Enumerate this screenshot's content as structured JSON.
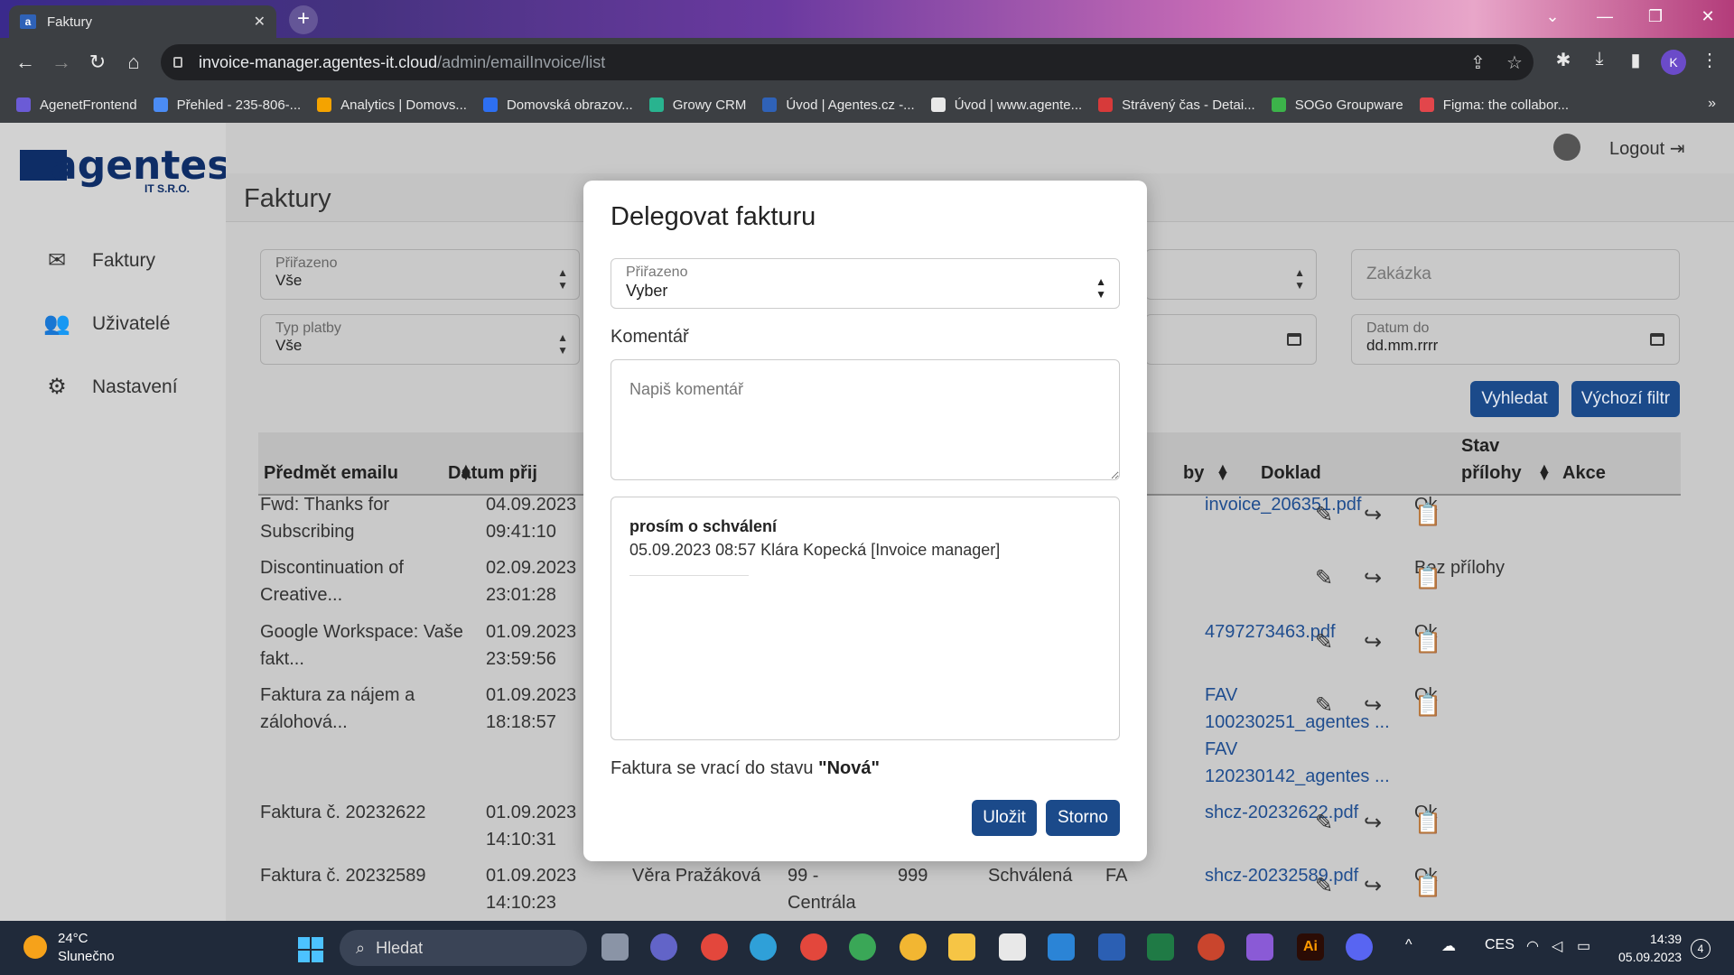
{
  "browser": {
    "tab_title": "Faktury",
    "tab_favicon": "a",
    "url_host": "invoice-manager.agentes-it.cloud",
    "url_path": "/admin/emailInvoice/list",
    "profile_initial": "K",
    "bookmarks": [
      {
        "label": "AgenetFrontend",
        "color": "#6b5bd6"
      },
      {
        "label": "Přehled - 235-806-...",
        "color": "#4b8cf5"
      },
      {
        "label": "Analytics | Domovs...",
        "color": "#f4a300"
      },
      {
        "label": "Domovská obrazov...",
        "color": "#2d6ff2"
      },
      {
        "label": "Growy CRM",
        "color": "#29b38f"
      },
      {
        "label": "Úvod | Agentes.cz -...",
        "color": "#2f62b8"
      },
      {
        "label": "Úvod | www.agente...",
        "color": "#e8e8e8"
      },
      {
        "label": "Strávený čas - Detai...",
        "color": "#d73a3a"
      },
      {
        "label": "SOGo Groupware",
        "color": "#3cb34a"
      },
      {
        "label": "Figma: the collabor...",
        "color": "#e2464b"
      }
    ]
  },
  "app": {
    "logo_text": "agentes",
    "logo_sub": "IT S.R.O.",
    "nav": [
      {
        "label": "Faktury",
        "icon": "envelope-open-icon"
      },
      {
        "label": "Uživatelé",
        "icon": "users-icon"
      },
      {
        "label": "Nastavení",
        "icon": "gear-icon"
      }
    ],
    "logout_label": "Logout",
    "page_title": "Faktury",
    "filters": {
      "assigned_label": "Přiřazeno",
      "assigned_value": "Vše",
      "payment_label": "Typ platby",
      "payment_value": "Vše",
      "order_placeholder": "Zakázka",
      "date_to_label": "Datum do",
      "date_to_value": "dd.mm.rrrr"
    },
    "search_button": "Vyhledat",
    "default_filter_button": "Výchozí filtr",
    "table_headers": {
      "subject": "Předmět emailu",
      "date": "Datum přij",
      "paytype_tail": "by",
      "document": "Doklad",
      "attachment_status_1": "Stav",
      "attachment_status_2": "přílohy",
      "actions": "Akce"
    },
    "rows": [
      {
        "subject1": "Fwd: Thanks for",
        "subject2": "Subscribing",
        "date": "04.09.2023",
        "time": "09:41:10",
        "doc1": "invoice_206351.pdf",
        "doc2": "",
        "doc3": "",
        "doc4": "",
        "status": "Ok"
      },
      {
        "subject1": "Discontinuation of",
        "subject2": "Creative...",
        "date": "02.09.2023",
        "time": "23:01:28",
        "doc1": "",
        "doc2": "",
        "doc3": "",
        "doc4": "",
        "status": "Bez přílohy"
      },
      {
        "subject1": "Google Workspace: Vaše",
        "subject2": "fakt...",
        "date": "01.09.2023",
        "time": "23:59:56",
        "doc1": "4797273463.pdf",
        "doc2": "",
        "doc3": "",
        "doc4": "",
        "status": "Ok"
      },
      {
        "subject1": "Faktura za nájem a",
        "subject2": "zálohová...",
        "date": "01.09.2023",
        "time": "18:18:57",
        "doc1": "FAV",
        "doc2": "100230251_agentes ...",
        "doc3": "FAV",
        "doc4": "120230142_agentes ...",
        "status": "Ok"
      },
      {
        "subject1": "Faktura č. 20232622",
        "subject2": "",
        "date": "01.09.2023",
        "time": "14:10:31",
        "doc1": "shcz-20232622.pdf",
        "doc2": "",
        "doc3": "",
        "doc4": "",
        "status": "Ok"
      },
      {
        "subject1": "Faktura č. 20232589",
        "subject2": "",
        "date": "01.09.2023",
        "time": "14:10:23",
        "doc1": "shcz-20232589.pdf",
        "doc2": "",
        "doc3": "",
        "doc4": "",
        "status": "Ok",
        "assignee": "Věra Pražáková",
        "center1": "99 -",
        "center2": "Centrála",
        "code": "999",
        "state": "Schválená",
        "paytype": "FA"
      }
    ]
  },
  "modal": {
    "title": "Delegovat fakturu",
    "assigned_label": "Přiřazeno",
    "assigned_value": "Vyber",
    "comment_label": "Komentář",
    "comment_placeholder": "Napiš komentář",
    "history_title": "prosím o schválení",
    "history_meta": "05.09.2023 08:57 Klára Kopecká [Invoice manager]",
    "status_text": "Faktura se vrací do stavu",
    "status_value": "\"Nová\"",
    "save_button": "Uložit",
    "cancel_button": "Storno"
  },
  "taskbar": {
    "weather_temp": "24°C",
    "weather_desc": "Slunečno",
    "search_label": "Hledat",
    "lang": "CES",
    "time": "14:39",
    "date": "05.09.2023",
    "notifications": "4"
  }
}
